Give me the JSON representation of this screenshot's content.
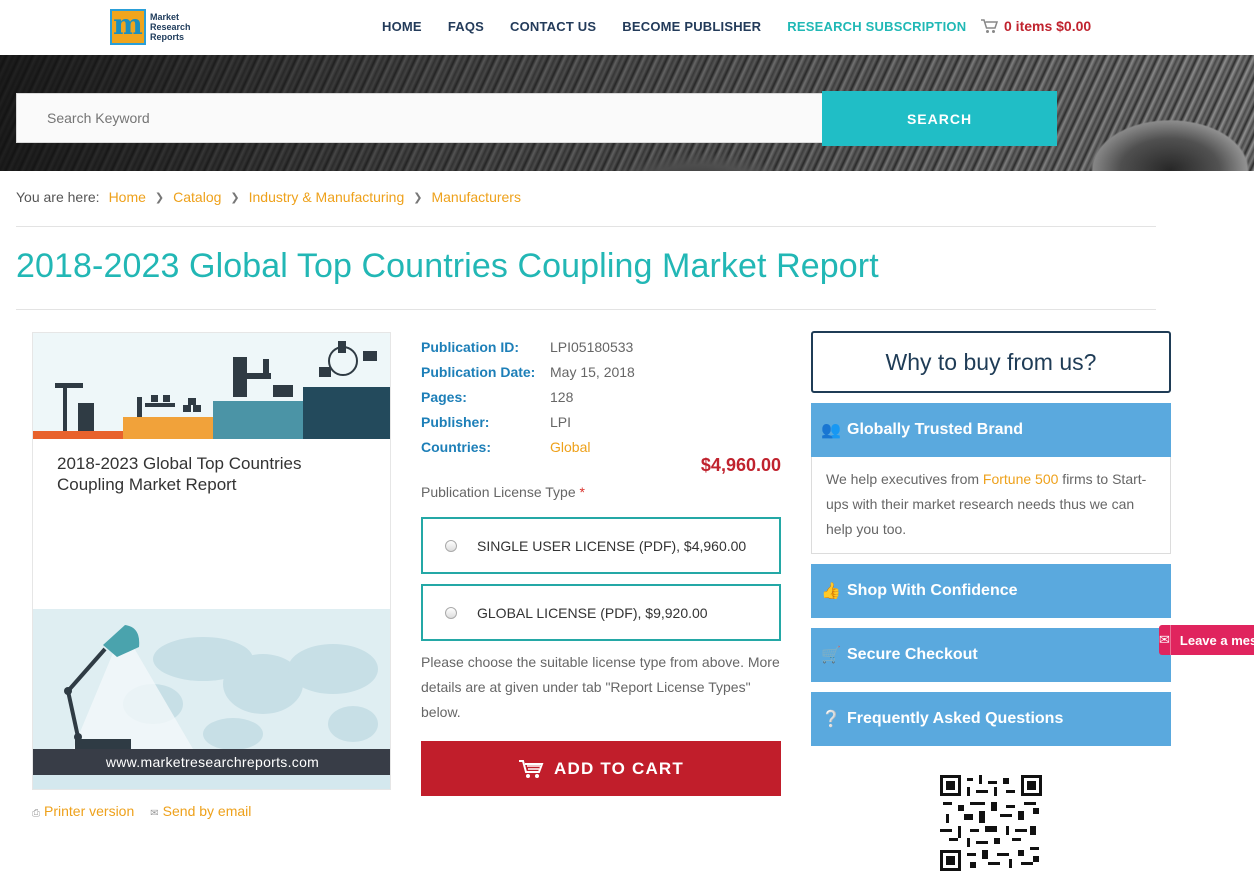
{
  "header": {
    "logo_lines": [
      "Market",
      "Research",
      "Reports"
    ],
    "logo_letter": "m",
    "nav": [
      "HOME",
      "FAQS",
      "CONTACT US",
      "BECOME PUBLISHER",
      "RESEARCH SUBSCRIPTION"
    ],
    "cart": "0 items $0.00"
  },
  "search": {
    "placeholder": "Search Keyword",
    "button": "SEARCH"
  },
  "breadcrumb": {
    "lead": "You are here:",
    "items": [
      "Home",
      "Catalog",
      "Industry & Manufacturing",
      "Manufacturers"
    ]
  },
  "title": "2018-2023 Global Top Countries Coupling Market Report",
  "cover": {
    "title": "2018-2023 Global Top Countries Coupling Market Report",
    "url": "www.marketresearchreports.com"
  },
  "doc_links": {
    "printer": "Printer version",
    "email": "Send by email"
  },
  "details": [
    {
      "label": "Publication ID:",
      "value": "LPI05180533"
    },
    {
      "label": "Publication Date:",
      "value": "May 15, 2018"
    },
    {
      "label": "Pages:",
      "value": "128"
    },
    {
      "label": "Publisher:",
      "value": "LPI"
    },
    {
      "label": "Countries:",
      "value": "Global"
    }
  ],
  "price": "$4,960.00",
  "license": {
    "label": "Publication License Type",
    "required_mark": "*",
    "options": [
      "SINGLE USER LICENSE (PDF), $4,960.00",
      "GLOBAL LICENSE (PDF), $9,920.00"
    ],
    "note": "Please choose the suitable license type from above. More details are at given under tab \"Report License Types\" below."
  },
  "add_to_cart": "ADD TO CART",
  "sidebar": {
    "why": "Why to buy from us?",
    "panels": [
      {
        "title": "Globally Trusted Brand",
        "icon": "users-icon"
      },
      {
        "title": "Shop With Confidence",
        "icon": "thumbs-up-icon"
      },
      {
        "title": "Secure Checkout",
        "icon": "cart-icon"
      },
      {
        "title": "Frequently Asked Questions",
        "icon": "question-circle-icon"
      }
    ],
    "body_pre": "We help executives from ",
    "body_hl": "Fortune 500",
    "body_post": " firms to Start-ups with their market research needs thus we can help you too."
  },
  "leave_message": "Leave a message",
  "colors": {
    "teal": "#20bec6",
    "title_teal": "#22b7b5",
    "navy": "#233b5a",
    "orange_link": "#eea11b",
    "red_price": "#c0232e",
    "panel_blue": "#5aa9de"
  }
}
